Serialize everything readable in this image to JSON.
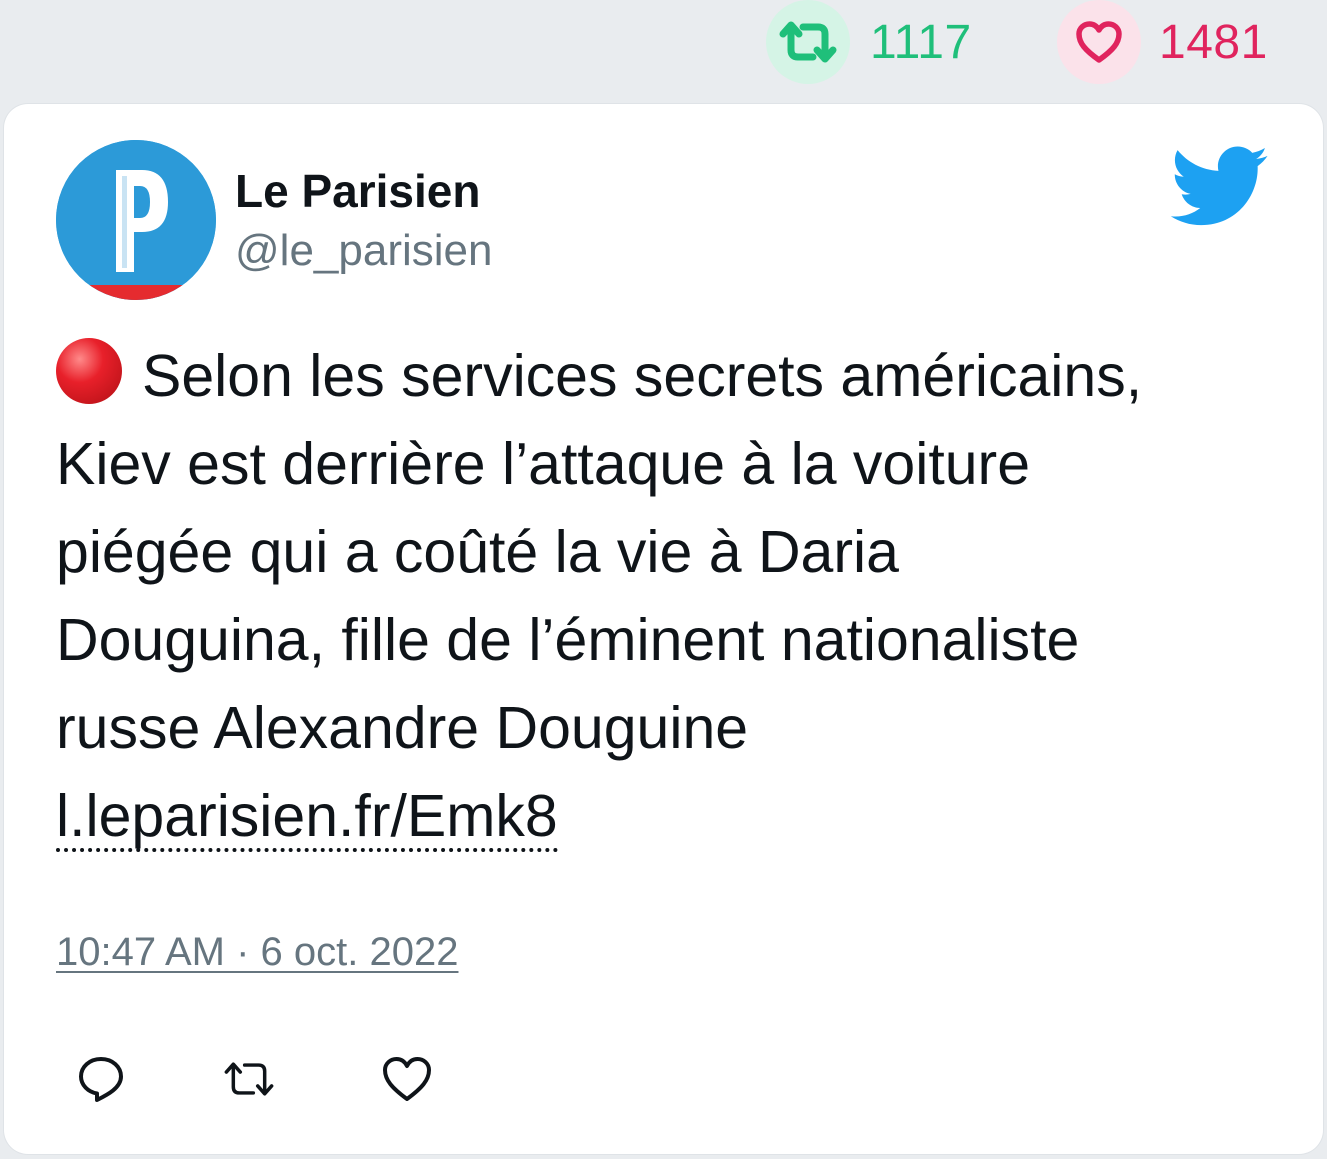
{
  "stats": {
    "retweet_count": "1117",
    "like_count": "1481",
    "retweet_icon": "retweet-icon",
    "like_icon": "heart-icon",
    "retweet_color": "#1fbf7a",
    "like_color": "#e0245e"
  },
  "tweet": {
    "author_name": "Le Parisien",
    "author_handle": "@le_parisien",
    "avatar_letter": "P",
    "text_lines": [
      "Selon les services secrets américains,",
      "Kiev est derrière l’attaque à la voiture",
      "piégée qui a coûté la vie à Daria",
      "Douguina, fille de l’éminent nationaliste",
      "russe Alexandre Douguine"
    ],
    "link": "l.leparisien.fr/Emk8",
    "timestamp": "10:47 AM · 6 oct. 2022",
    "brand_color": "#1da1f2"
  },
  "actions": [
    "reply-icon",
    "retweet-icon",
    "heart-icon"
  ]
}
